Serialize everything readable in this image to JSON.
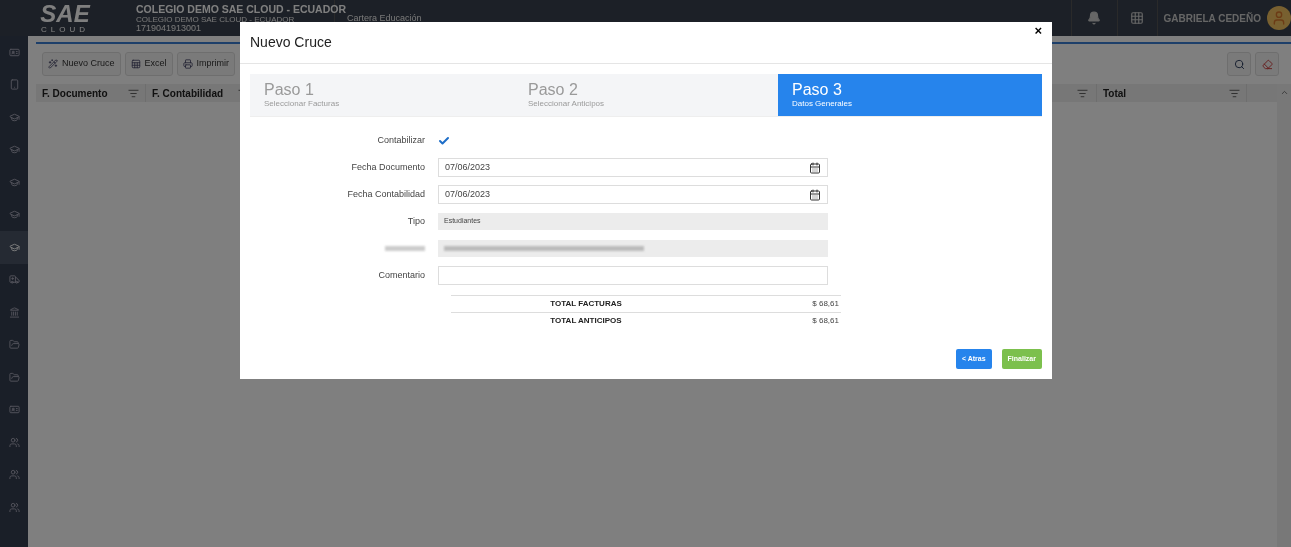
{
  "header": {
    "logo": "SAE",
    "logo_tagline": "CLOUD",
    "company": "COLEGIO DEMO SAE CLOUD - ECUADOR",
    "company_sub": "COLEGIO DEMO SAE CLOUD - ECUADOR",
    "ruc": "1719041913001",
    "module": "Cartera Educación",
    "user": "GABRIELA CEDEÑO"
  },
  "sidebar": {
    "items": [
      {
        "selected": false
      },
      {
        "selected": false
      },
      {
        "selected": false
      },
      {
        "selected": false
      },
      {
        "selected": false
      },
      {
        "selected": false
      },
      {
        "selected": true
      },
      {
        "selected": false
      },
      {
        "selected": false
      },
      {
        "selected": false
      },
      {
        "selected": false
      },
      {
        "selected": false
      },
      {
        "selected": false
      },
      {
        "selected": false
      },
      {
        "selected": false
      }
    ]
  },
  "toolbar": {
    "buttons": [
      "Nuevo Cruce",
      "Excel",
      "Imprimir"
    ]
  },
  "table": {
    "columns": [
      {
        "label": "F. Documento"
      },
      {
        "label": "F. Contabilidad"
      },
      {
        "label": "Total"
      }
    ]
  },
  "modal": {
    "title": "Nuevo Cruce",
    "close": "×",
    "steps": [
      {
        "title": "Paso 1",
        "subtitle": "Seleccionar Facturas",
        "selected": false
      },
      {
        "title": "Paso 2",
        "subtitle": "Seleccionar Anticipos",
        "selected": false
      },
      {
        "title": "Paso 3",
        "subtitle": "Datos Generales",
        "selected": true
      }
    ],
    "fields": [
      {
        "kind": "checkbox",
        "label": "Contabilizar",
        "checked": true
      },
      {
        "kind": "date",
        "label": "Fecha Documento",
        "value": "07/06/2023"
      },
      {
        "kind": "date",
        "label": "Fecha Contabilidad",
        "value": "07/06/2023"
      },
      {
        "kind": "readonly",
        "label": "Tipo",
        "value": "Estudiantes"
      },
      {
        "kind": "redacted"
      },
      {
        "kind": "text",
        "label": "Comentario"
      }
    ],
    "totals": [
      {
        "label": "TOTAL FACTURAS",
        "value": "$ 68,61"
      },
      {
        "label": "TOTAL ANTICIPOS",
        "value": "$ 68,61"
      }
    ],
    "buttons": [
      {
        "kind": "back",
        "label": "< Atras"
      },
      {
        "kind": "finish",
        "label": "Finalizar"
      }
    ]
  }
}
